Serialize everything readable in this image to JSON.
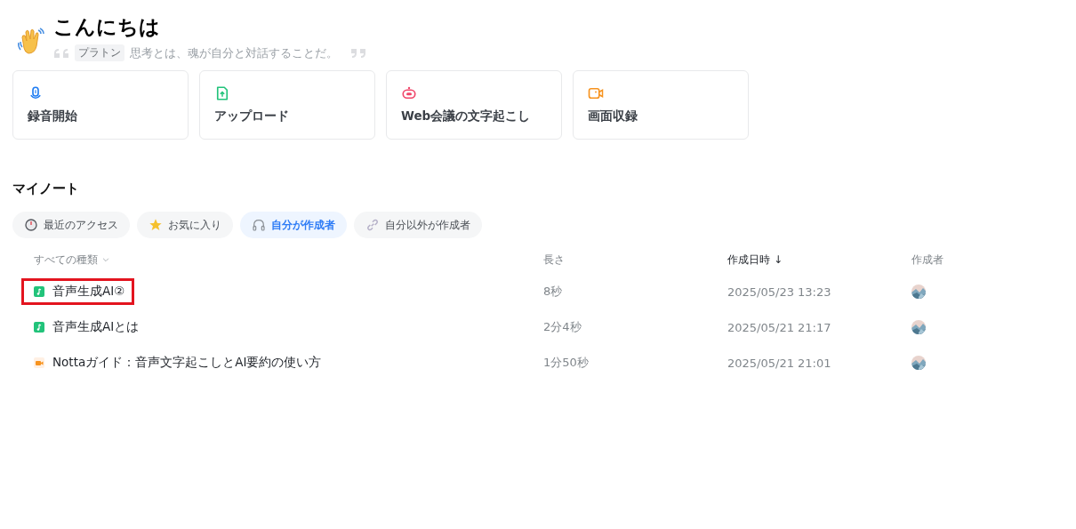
{
  "greeting": {
    "title": "こんにちは",
    "quote_author": "プラトン",
    "quote": "思考とは、魂が自分と対話することだ。"
  },
  "actions": [
    {
      "kind": "record",
      "label": "録音開始"
    },
    {
      "kind": "upload",
      "label": "アップロード"
    },
    {
      "kind": "meeting",
      "label": "Web会議の文字起こし"
    },
    {
      "kind": "screen",
      "label": "画面収録"
    }
  ],
  "section_title": "マイノート",
  "tabs": [
    {
      "kind": "recent",
      "label": "最近のアクセス",
      "selected": false
    },
    {
      "kind": "favorite",
      "label": "お気に入り",
      "selected": false
    },
    {
      "kind": "mine",
      "label": "自分が作成者",
      "selected": true
    },
    {
      "kind": "shared",
      "label": "自分以外が作成者",
      "selected": false
    }
  ],
  "table": {
    "columns": [
      {
        "label": "すべての種類",
        "kind": "filter",
        "sorted": false
      },
      {
        "label": "長さ",
        "kind": "plain",
        "sorted": false
      },
      {
        "label": "作成日時",
        "kind": "plain",
        "sorted": true,
        "sort_mark": "↓"
      },
      {
        "label": "作成者",
        "kind": "plain",
        "sorted": false
      }
    ],
    "rows": [
      {
        "kind": "audio",
        "title": "音声生成AI②",
        "highlighted": true,
        "length": "8秒",
        "created": "2025/05/23 13:23"
      },
      {
        "kind": "audio",
        "title": "音声生成AIとは",
        "highlighted": false,
        "length": "2分4秒",
        "created": "2025/05/21 21:17"
      },
      {
        "kind": "video",
        "title": "Nottaガイド：音声文字起こしとAI要約の使い方",
        "highlighted": false,
        "length": "1分50秒",
        "created": "2025/05/21 21:01"
      }
    ]
  }
}
